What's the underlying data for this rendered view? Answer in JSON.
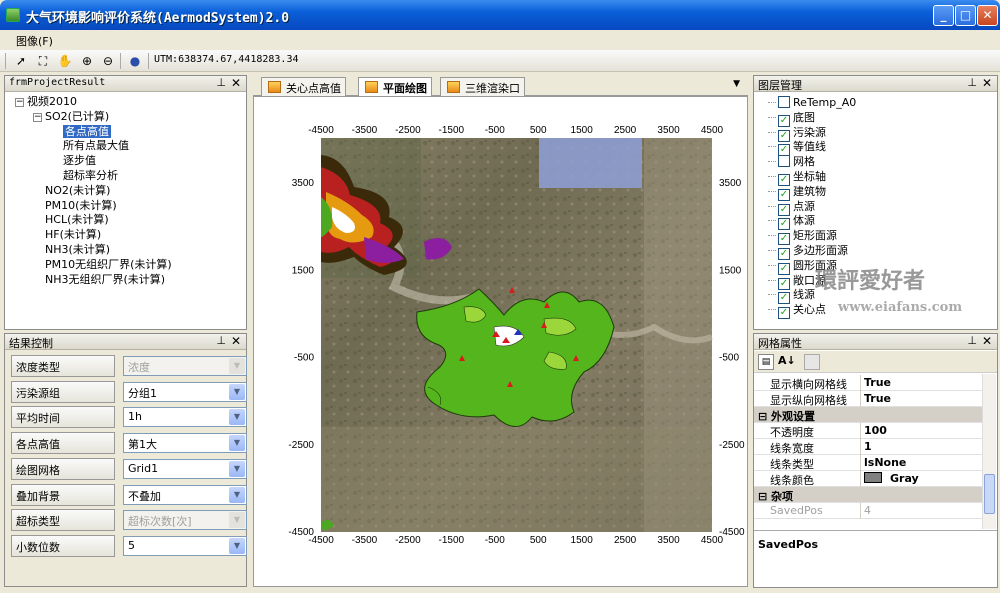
{
  "window": {
    "title": "大气环境影响评价系统(AermodSystem)2.0",
    "minimize": "_",
    "maximize": "□",
    "close": "✕"
  },
  "menu": {
    "image": "图像(F)"
  },
  "toolbar": {
    "utm": "UTM:638374.67,4418283.34"
  },
  "project_panel": {
    "title": "frmProjectResult",
    "tree": [
      {
        "label": "视频2010",
        "indent": 0,
        "exp": "⊟"
      },
      {
        "label": "SO2(已计算)",
        "indent": 1,
        "exp": "⊟"
      },
      {
        "label": "各点高值",
        "indent": 2,
        "selected": true
      },
      {
        "label": "所有点最大值",
        "indent": 2
      },
      {
        "label": "逐步值",
        "indent": 2
      },
      {
        "label": "超标率分析",
        "indent": 2
      },
      {
        "label": "NO2(未计算)",
        "indent": 1
      },
      {
        "label": "PM10(未计算)",
        "indent": 1
      },
      {
        "label": "HCL(未计算)",
        "indent": 1
      },
      {
        "label": "HF(未计算)",
        "indent": 1
      },
      {
        "label": "NH3(未计算)",
        "indent": 1
      },
      {
        "label": "PM10无组织厂界(未计算)",
        "indent": 1
      },
      {
        "label": "NH3无组织厂界(未计算)",
        "indent": 1
      }
    ]
  },
  "result_panel": {
    "title": "结果控制",
    "rows": [
      {
        "label": "浓度类型",
        "value": "浓度",
        "disabled": true
      },
      {
        "label": "污染源组",
        "value": "分组1"
      },
      {
        "label": "平均时间",
        "value": "1h"
      },
      {
        "label": "各点高值",
        "value": "第1大"
      },
      {
        "label": "绘图网格",
        "value": "Grid1"
      },
      {
        "label": "叠加背景",
        "value": "不叠加"
      },
      {
        "label": "超标类型",
        "value": "超标次数[次]",
        "disabled": true
      },
      {
        "label": "小数位数",
        "value": "5"
      }
    ]
  },
  "tabs": [
    {
      "label": "关心点高值"
    },
    {
      "label": "平面绘图",
      "active": true
    },
    {
      "label": "三维渲染口"
    }
  ],
  "map": {
    "x_ticks": [
      "-4500",
      "-3500",
      "-2500",
      "-1500",
      "-500",
      "500",
      "1500",
      "2500",
      "3500",
      "4500"
    ],
    "y_ticks": [
      "3500",
      "1500",
      "-500",
      "-2500",
      "-4500"
    ]
  },
  "layers_panel": {
    "title": "图层管理",
    "layers": [
      {
        "label": "ReTemp_A0",
        "checked": false
      },
      {
        "label": "底图",
        "checked": true
      },
      {
        "label": "污染源",
        "checked": true
      },
      {
        "label": "等值线",
        "checked": true
      },
      {
        "label": "网格",
        "checked": false
      },
      {
        "label": "坐标轴",
        "checked": true
      },
      {
        "label": "建筑物",
        "checked": true
      },
      {
        "label": "点源",
        "checked": true
      },
      {
        "label": "体源",
        "checked": true
      },
      {
        "label": "矩形面源",
        "checked": true
      },
      {
        "label": "多边形面源",
        "checked": true
      },
      {
        "label": "圆形面源",
        "checked": true
      },
      {
        "label": "敞口源",
        "checked": true
      },
      {
        "label": "线源",
        "checked": true
      },
      {
        "label": "关心点",
        "checked": true
      }
    ]
  },
  "grid_props": {
    "title": "网格属性",
    "rows": [
      {
        "name": "显示横向网格线",
        "value": "True"
      },
      {
        "name": "显示纵向网格线",
        "value": "True"
      },
      {
        "name": "外观设置",
        "category": true
      },
      {
        "name": "不透明度",
        "value": "100"
      },
      {
        "name": "线条宽度",
        "value": "1"
      },
      {
        "name": "线条类型",
        "value": "lsNone"
      },
      {
        "name": "线条颜色",
        "value": "Gray"
      },
      {
        "name": "杂项",
        "category": true
      },
      {
        "name": "SavedPos",
        "value": "4",
        "disabled": true
      }
    ],
    "description": "SavedPos"
  },
  "watermark": {
    "line1": "環評愛好者",
    "line2": "www.eiafans.com"
  }
}
